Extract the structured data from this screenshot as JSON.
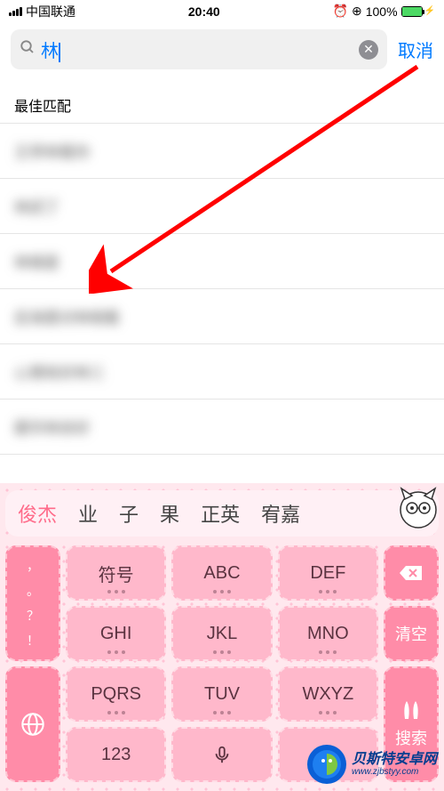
{
  "status": {
    "carrier": "中国联通",
    "time": "20:40",
    "battery_pct": "100%"
  },
  "search": {
    "query": "林",
    "cancel_label": "取消"
  },
  "section_header": "最佳匹配",
  "results": [
    "王亭林看你",
    "林武丁",
    "林维星",
    "后海里对林相看",
    "心情有好林三",
    "跟华林余好"
  ],
  "keyboard": {
    "candidates": [
      "俊杰",
      "业",
      "子",
      "果",
      "正英",
      "宥嘉"
    ],
    "punct_key": [
      "，",
      "。",
      "？",
      "！"
    ],
    "keys_main": [
      [
        "符号",
        "ABC",
        "DEF"
      ],
      [
        "GHI",
        "JKL",
        "MNO"
      ],
      [
        "PQRS",
        "TUV",
        "WXYZ"
      ],
      [
        "123",
        "mic",
        "中/"
      ]
    ],
    "clear_label": "清空",
    "search_label": "搜索"
  },
  "watermark": {
    "cn": "贝斯特安卓网",
    "en": "www.zjbstyy.com"
  }
}
